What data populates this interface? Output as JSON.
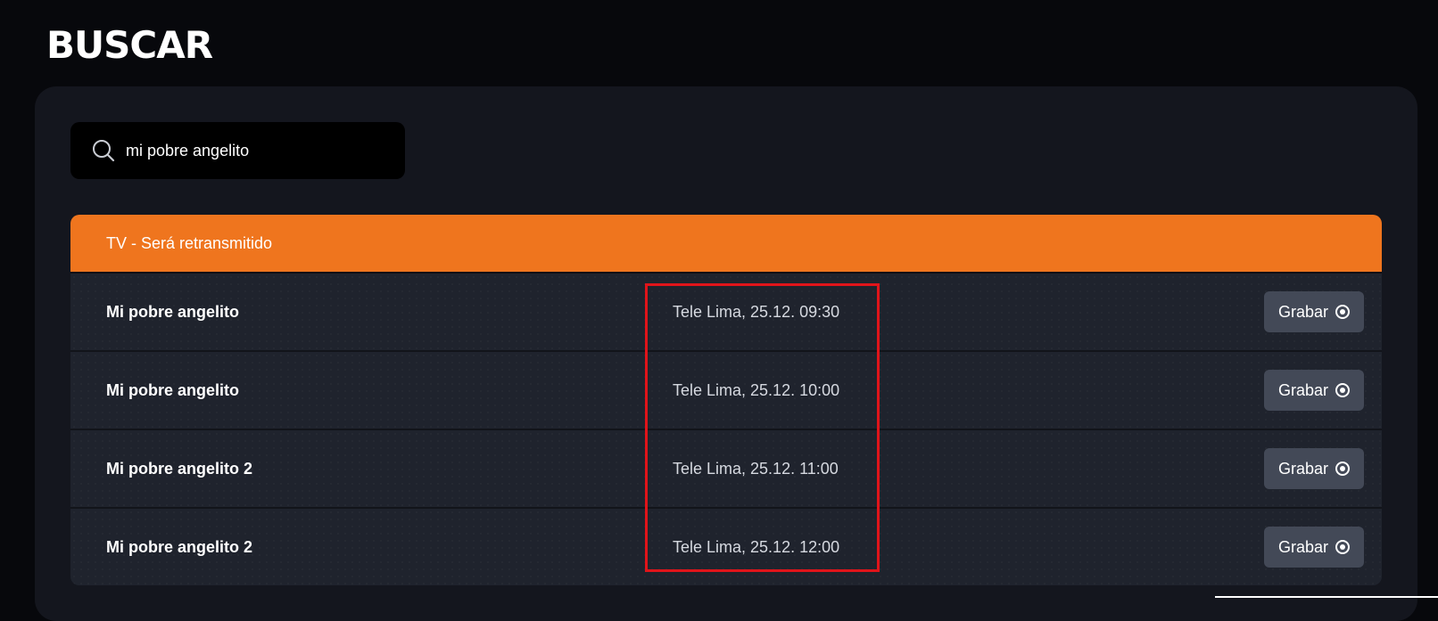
{
  "header": {
    "title": "BUSCAR"
  },
  "search": {
    "value": "mi pobre angelito",
    "icon": "search-icon"
  },
  "results": {
    "section_title": "TV - Será retransmitido",
    "accent_color": "#ef751e",
    "rows": [
      {
        "title": "Mi pobre angelito",
        "schedule": "Tele Lima, 25.12. 09:30",
        "action_label": "Grabar"
      },
      {
        "title": "Mi pobre angelito",
        "schedule": "Tele Lima, 25.12. 10:00",
        "action_label": "Grabar"
      },
      {
        "title": "Mi pobre angelito 2",
        "schedule": "Tele Lima, 25.12. 11:00",
        "action_label": "Grabar"
      },
      {
        "title": "Mi pobre angelito 2",
        "schedule": "Tele Lima, 25.12. 12:00",
        "action_label": "Grabar"
      }
    ]
  },
  "annotation": {
    "color": "#e0141a"
  }
}
